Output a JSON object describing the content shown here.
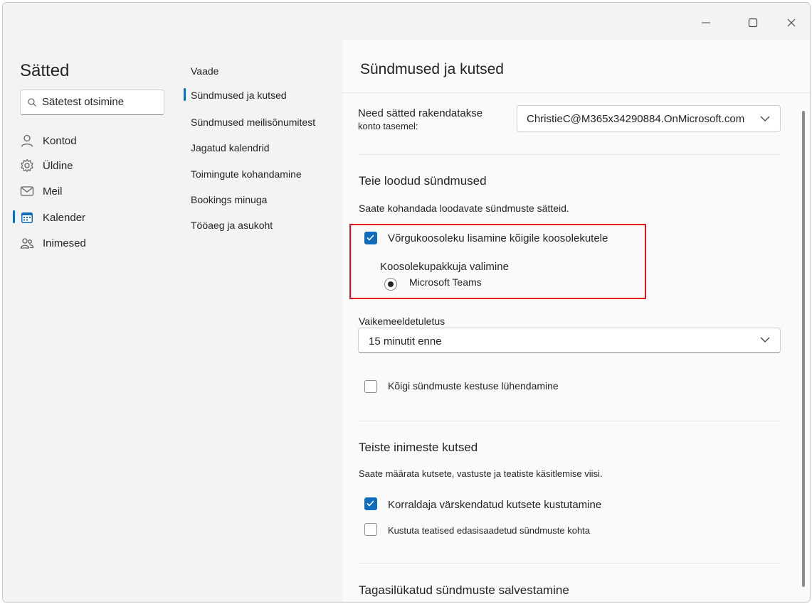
{
  "sidebar": {
    "title": "Sätted",
    "search_placeholder": "Sätetest otsimine",
    "items": [
      {
        "label": "Kontod",
        "icon": "person-icon",
        "selected": false
      },
      {
        "label": "Üldine",
        "icon": "gear-icon",
        "selected": false
      },
      {
        "label": "Meil",
        "icon": "mail-icon",
        "selected": false
      },
      {
        "label": "Kalender",
        "icon": "calendar-icon",
        "selected": true
      },
      {
        "label": "Inimesed",
        "icon": "people-icon",
        "selected": false
      }
    ]
  },
  "subnav": {
    "header": "Vaade",
    "items": [
      {
        "label": "Sündmused ja kutsed",
        "selected": true
      },
      {
        "label": "Sündmused meilisõnumitest",
        "selected": false
      },
      {
        "label": "Jagatud kalendrid",
        "selected": false
      },
      {
        "label": "Toimingute kohandamine",
        "selected": false
      },
      {
        "label": "Bookings minuga",
        "selected": false
      },
      {
        "label": "Tööaeg ja asukoht",
        "selected": false
      }
    ]
  },
  "main": {
    "title": "Sündmused ja kutsed",
    "account_label_line1": "Need sätted rakendatakse",
    "account_label_line2": "konto tasemel:",
    "account_value": "ChristieC@M365x34290884.OnMicrosoft.com",
    "section1": {
      "title": "Teie loodud sündmused",
      "desc": "Saate kohandada loodavate sündmuste sätteid.",
      "online_meeting_label": "Võrgukoosoleku lisamine kõigile koosolekutele",
      "online_meeting_checked": true,
      "provider_label": "Koosolekupakkuja valimine",
      "provider_option": "Microsoft Teams",
      "provider_radio_text": "(e)",
      "reminder_label": "Vaikemeeldetuletus",
      "reminder_value": "15 minutit enne",
      "shorten_label": "Kõigi sündmuste kestuse lühendamine",
      "shorten_checked": false
    },
    "section2": {
      "title": "Teiste inimeste kutsed",
      "desc": "Saate määrata kutsete, vastuste ja teatiste käsitlemise viisi.",
      "delete_updated_label": "Korraldaja värskendatud kutsete kustutamine",
      "delete_updated_checked": true,
      "delete_forward_label": "Kustuta teatised edasisaadetud sündmuste kohta",
      "delete_forward_checked": false
    },
    "section3": {
      "title": "Tagasilükatud sündmuste salvestamine"
    }
  },
  "colors": {
    "accent": "#0f6cbd",
    "highlight_border": "#e81123",
    "pane_bg": "#f3f3f3"
  }
}
